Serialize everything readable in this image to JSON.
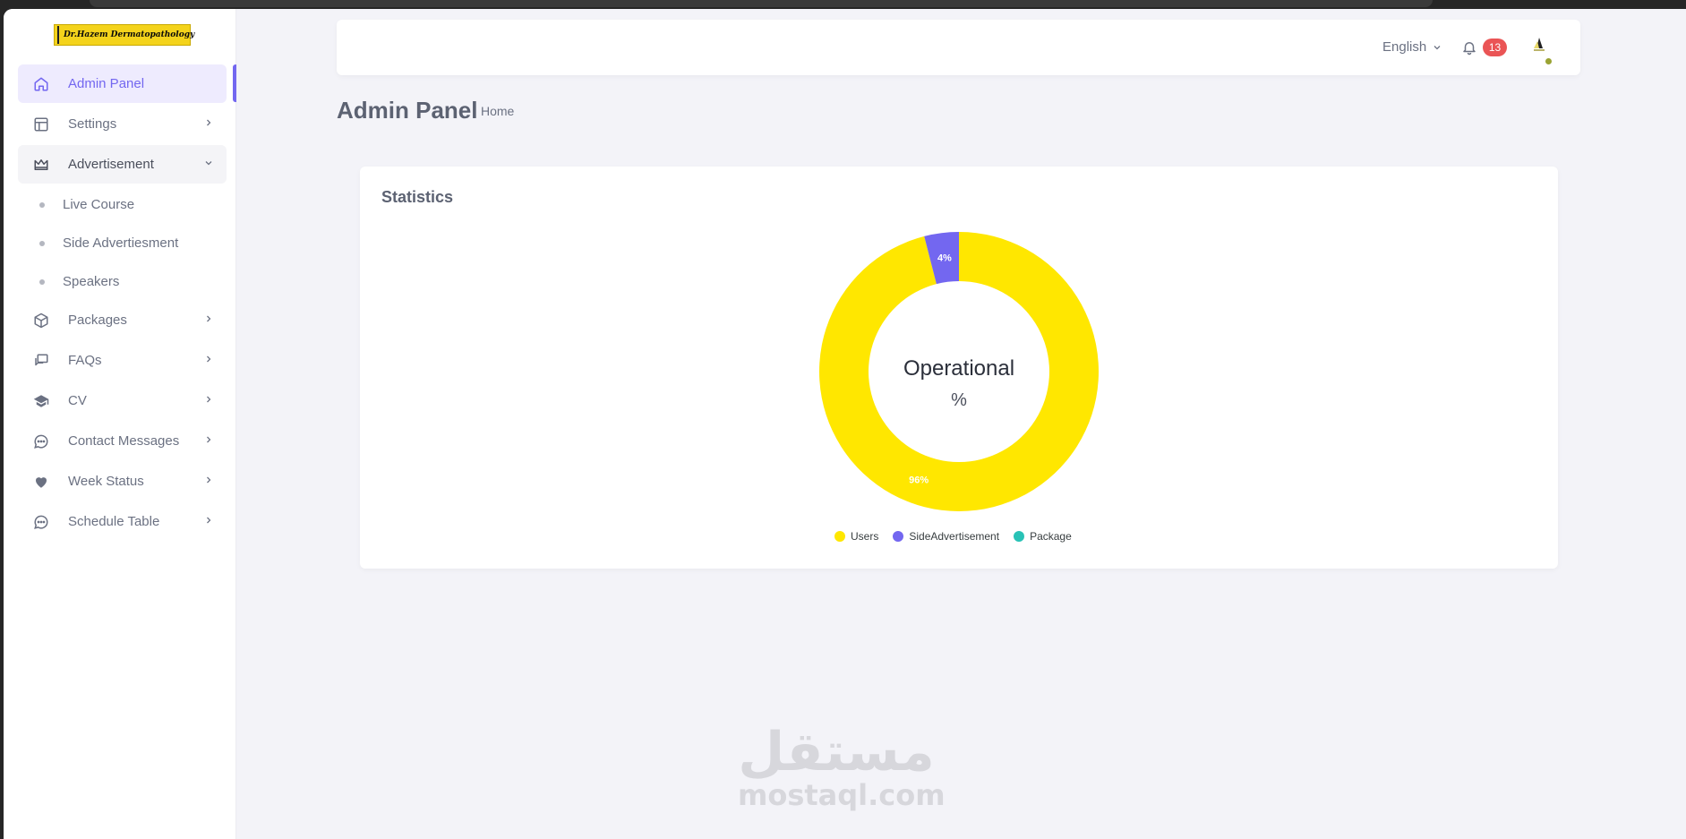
{
  "brand": {
    "logo_text": "Dr.Hazem Dermatopathology"
  },
  "sidebar": {
    "items": [
      {
        "label": "Admin Panel",
        "icon": "home-icon",
        "state": "active"
      },
      {
        "label": "Settings",
        "icon": "layout-icon",
        "state": "collapsed"
      },
      {
        "label": "Advertisement",
        "icon": "crown-icon",
        "state": "open",
        "children": [
          "Live Course",
          "Side Advertiesment",
          "Speakers"
        ]
      },
      {
        "label": "Packages",
        "icon": "box-icon",
        "state": "collapsed"
      },
      {
        "label": "FAQs",
        "icon": "chat-squares-icon",
        "state": "collapsed"
      },
      {
        "label": "CV",
        "icon": "graduation-cap-icon",
        "state": "collapsed"
      },
      {
        "label": "Contact Messages",
        "icon": "message-circle-icon",
        "state": "collapsed"
      },
      {
        "label": "Week Status",
        "icon": "heart-icon",
        "state": "collapsed"
      },
      {
        "label": "Schedule Table",
        "icon": "message-circle-icon",
        "state": "collapsed"
      }
    ]
  },
  "header": {
    "language": "English",
    "notification_count": "13"
  },
  "page": {
    "title": "Admin Panel",
    "breadcrumb": "Home"
  },
  "statistics": {
    "title": "Statistics",
    "center_label": "Operational",
    "center_value": "%"
  },
  "chart_data": {
    "type": "pie",
    "variant": "donut",
    "series": [
      {
        "name": "Users",
        "value": 96,
        "label": "96%",
        "color": "#ffe700"
      },
      {
        "name": "SideAdvertisement",
        "value": 4,
        "label": "4%",
        "color": "#7367f0"
      },
      {
        "name": "Package",
        "value": 0,
        "label": "0%",
        "color": "#28c2b6"
      }
    ],
    "legend_position": "bottom"
  },
  "watermark": {
    "arabic": "مستقل",
    "latin": "mostaql.com"
  },
  "colors": {
    "accent": "#7367f0",
    "badge": "#ea5455",
    "background": "#f3f3f8"
  }
}
